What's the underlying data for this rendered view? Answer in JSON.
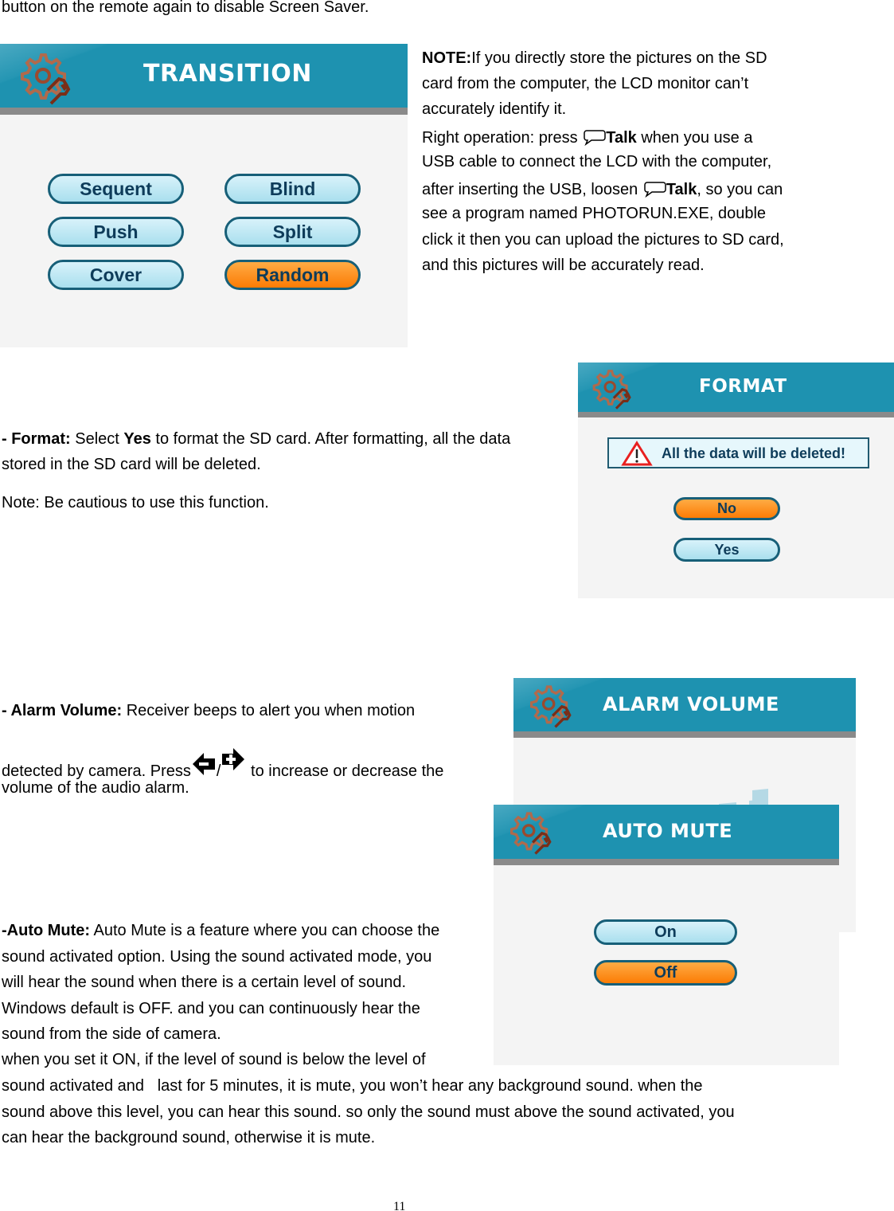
{
  "intro": "button on the remote again to disable Screen Saver.",
  "note": {
    "l1b": "NOTE:",
    "l1": "If you directly store the pictures on the SD",
    "l2": "card from the computer, the LCD monitor can’t",
    "l3": "accurately identify it.",
    "l4a": "Right operation: press ",
    "l4b": "Talk",
    "l4c": " when you use a",
    "l5": "USB cable to connect the LCD with the computer,",
    "l6a": "after inserting the USB, loosen ",
    "l6b": "Talk",
    "l6c": ", so you can",
    "l7": "see a program named PHOTORUN.EXE, double",
    "l8": "click it then you can upload the pictures to SD card,",
    "l9": "and this pictures will be accurately read."
  },
  "transition": {
    "title": "TRANSITION",
    "buttons": [
      "Sequent",
      "Blind",
      "Push",
      "Split",
      "Cover",
      "Random"
    ],
    "selected": "Random"
  },
  "format_text": {
    "l1b": "- Format:",
    "l1a": " Select ",
    "l1c": "Yes",
    "l1d": " to format the SD card. After formatting, all the data",
    "l2": "stored in the SD card will be deleted.",
    "l3": "Note: Be cautious to use this function."
  },
  "format_panel": {
    "title": "FORMAT",
    "warning": "All the data will be deleted!",
    "no": "No",
    "yes": "Yes",
    "selected": "No"
  },
  "alarm_text": {
    "l1b": "- Alarm Volume:",
    "l1": " Receiver beeps to alert you when motion",
    "l2a": "detected by camera. Press",
    "l2s": "/",
    "l2b": "  to increase or decrease the",
    "l3": "volume of the audio alarm."
  },
  "alarm_panel": {
    "title": "ALARM VOLUME"
  },
  "automute_text": {
    "l1b": "-Auto Mute:",
    "l1": " Auto Mute is a feature where you can choose the",
    "l2": "sound activated option. Using the sound activated mode, you",
    "l3": "will hear the sound when there is a certain level of sound.",
    "l4": "Windows default is OFF. and you can continuously hear the",
    "l5": "sound from the side of camera.",
    "l6": "when you set it ON, if the level of sound is below the level of",
    "l7": "sound activated and   last for 5 minutes, it is mute, you won’t hear any background sound. when the",
    "l8": "sound above this level, you can hear this sound. so only the sound must above the sound activated, you",
    "l9": "can hear the background sound, otherwise it is mute."
  },
  "automute_panel": {
    "title": "AUTO MUTE",
    "on": "On",
    "off": "Off",
    "selected": "Off"
  },
  "page_number": "11",
  "colors": {
    "header": "#1e92b0",
    "selected": "#fb7c05",
    "button": "#a9dfee"
  }
}
